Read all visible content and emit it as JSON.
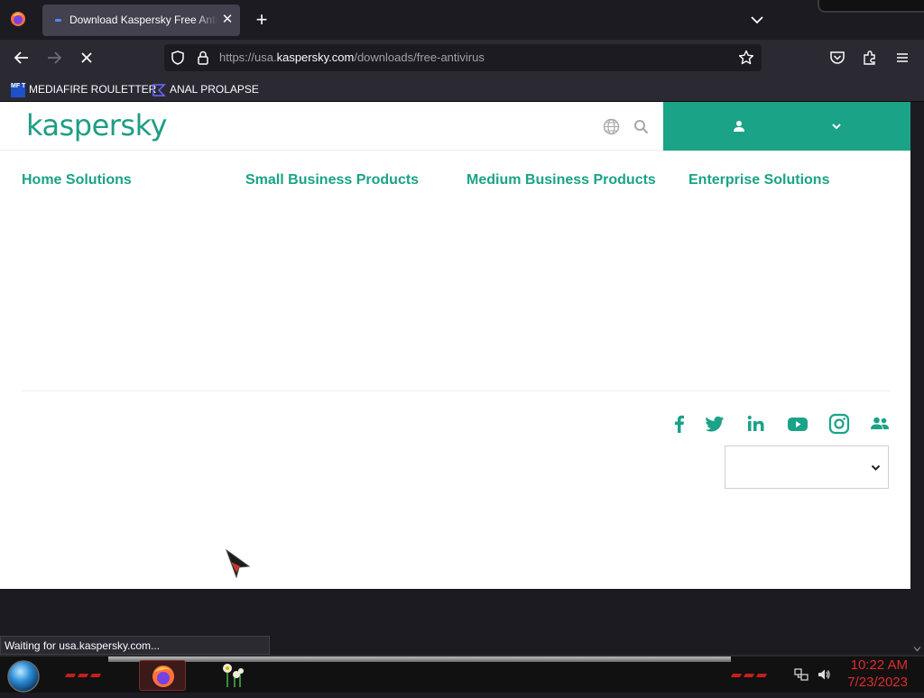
{
  "browser": {
    "tab": {
      "title": "Download Kaspersky Free Antivirus"
    },
    "url": {
      "prefix": "https://usa.",
      "domain": "kaspersky.com",
      "path": "/downloads/free-antivirus"
    },
    "bookmarks": [
      {
        "label": "MEDIAFIRE ROULETTER",
        "icon_text": "MF T"
      },
      {
        "label": "ANAL PROLAPSE"
      }
    ],
    "status": "Waiting for usa.kaspersky.com..."
  },
  "page": {
    "logo": "kaspersky",
    "nav": [
      "Home Solutions",
      "Small Business Products",
      "Medium Business Products",
      "Enterprise Solutions"
    ],
    "social_icons": [
      "facebook-icon",
      "twitter-icon",
      "linkedin-icon",
      "youtube-icon",
      "instagram-icon",
      "community-icon"
    ],
    "region_select": {
      "value": ""
    }
  },
  "taskbar": {
    "time": "10:22 AM",
    "date": "7/23/2023"
  },
  "colors": {
    "brand": "#1aa386",
    "chrome": "#2b2a33",
    "clock": "#e02a2a"
  }
}
